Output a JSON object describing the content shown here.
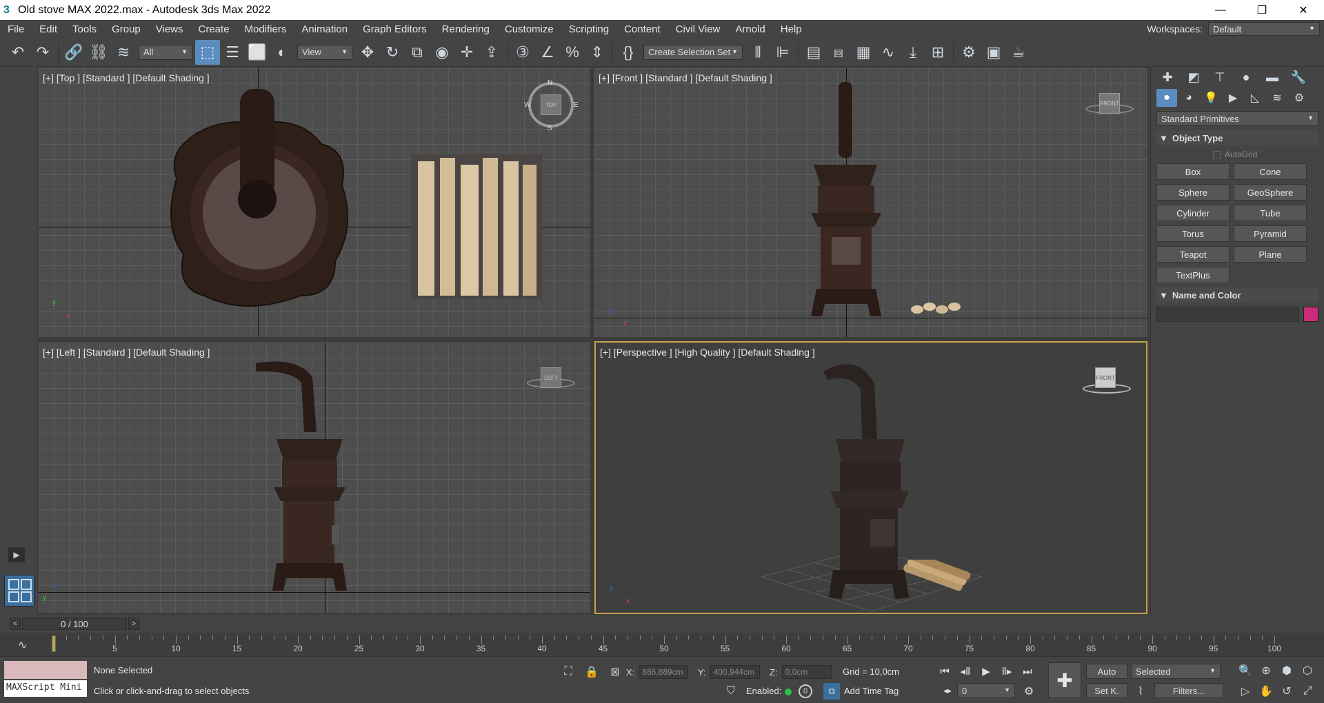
{
  "window": {
    "title": "Old stove MAX 2022.max - Autodesk 3ds Max 2022",
    "app_icon": "3"
  },
  "menu": [
    "File",
    "Edit",
    "Tools",
    "Group",
    "Views",
    "Create",
    "Modifiers",
    "Animation",
    "Graph Editors",
    "Rendering",
    "Customize",
    "Scripting",
    "Content",
    "Civil View",
    "Arnold",
    "Help"
  ],
  "workspace": {
    "label": "Workspaces:",
    "value": "Default"
  },
  "toolbar": {
    "selection_filter": "All",
    "ref_coord": "View",
    "selection_set": "Create Selection Set"
  },
  "viewports": {
    "top": {
      "label": "[+] [Top ] [Standard ] [Default Shading ]",
      "cube": "TOP"
    },
    "front": {
      "label": "[+] [Front ] [Standard ] [Default Shading ]",
      "cube": "FRONT"
    },
    "left": {
      "label": "[+] [Left ] [Standard ] [Default Shading ]",
      "cube": "LEFT"
    },
    "perspective": {
      "label": "[+] [Perspective ] [High Quality ] [Default Shading ]",
      "cube": "FRONT"
    },
    "compass": {
      "n": "N",
      "s": "S",
      "e": "E",
      "w": "W"
    }
  },
  "command_panel": {
    "category": "Standard Primitives",
    "object_type_title": "Object Type",
    "autogrid": "AutoGrid",
    "objects": [
      "Box",
      "Cone",
      "Sphere",
      "GeoSphere",
      "Cylinder",
      "Tube",
      "Torus",
      "Pyramid",
      "Teapot",
      "Plane",
      "TextPlus"
    ],
    "name_color_title": "Name and Color",
    "object_color": "#cc2a7a"
  },
  "timeline": {
    "frame_display": "0 / 100",
    "ticks": [
      "5",
      "10",
      "15",
      "20",
      "25",
      "30",
      "35",
      "40",
      "45",
      "50",
      "55",
      "60",
      "65",
      "70",
      "75",
      "80",
      "85",
      "90",
      "95",
      "100"
    ]
  },
  "status": {
    "maxscript_placeholder": "MAXScript Mini",
    "selection": "None Selected",
    "prompt": "Click or click-and-drag to select objects",
    "x_label": "X:",
    "x_value": "886,889cm",
    "y_label": "Y:",
    "y_value": "400,944cm",
    "z_label": "Z:",
    "z_value": "0,0cm",
    "grid": "Grid = 10,0cm",
    "enabled_label": "Enabled:",
    "add_time_tag": "Add Time Tag",
    "auto_key": "Auto",
    "set_key": "Set K.",
    "key_filter": "Selected",
    "filters": "Filters...",
    "current_frame": "0"
  }
}
